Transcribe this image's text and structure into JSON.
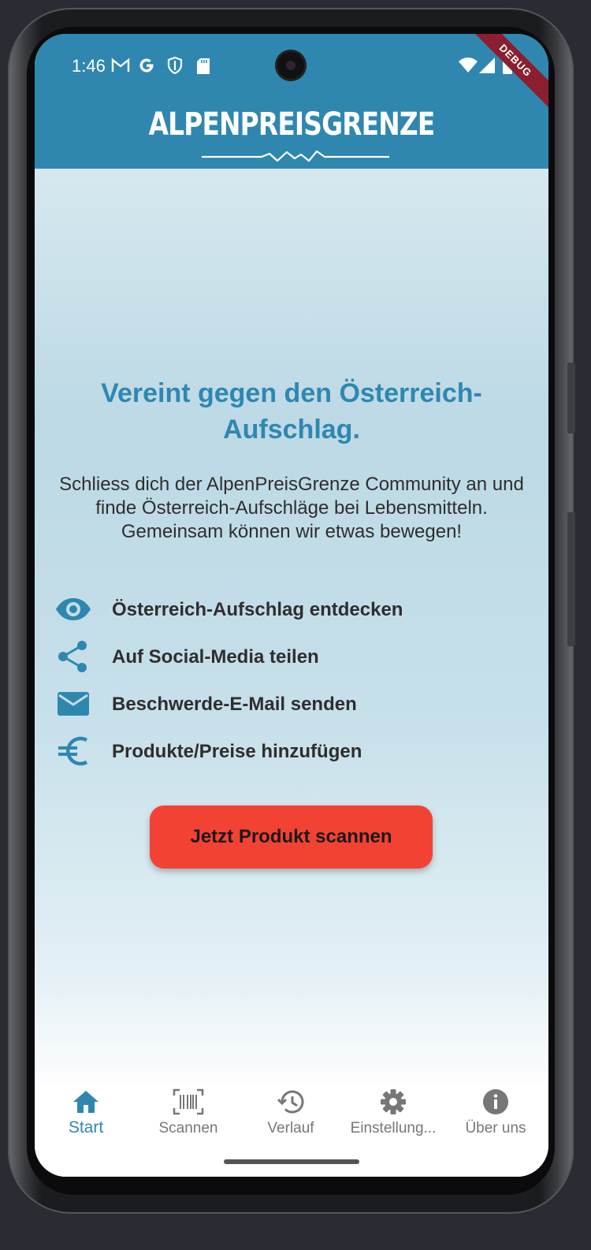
{
  "status_bar": {
    "time": "1:46"
  },
  "app_bar": {
    "logo_text": "ALPENPREISGRENZE",
    "debug_banner": "DEBUG",
    "color": "#2f87b0"
  },
  "main": {
    "headline": "Vereint gegen den Österreich-Aufschlag.",
    "description": "Schliess dich der AlpenPreisGrenze Community an und finde Österreich-Aufschläge bei Lebensmitteln. Gemeinsam können wir etwas bewegen!",
    "features": [
      {
        "icon": "eye-icon",
        "label": "Österreich-Aufschlag entdecken"
      },
      {
        "icon": "share-icon",
        "label": "Auf Social-Media teilen"
      },
      {
        "icon": "mail-icon",
        "label": "Beschwerde-E-Mail senden"
      },
      {
        "icon": "euro-icon",
        "label": "Produkte/Preise hinzufügen"
      }
    ],
    "cta_label": "Jetzt Produkt scannen",
    "cta_color": "#f24234"
  },
  "bottom_nav": {
    "items": [
      {
        "icon": "home-icon",
        "label": "Start",
        "active": true
      },
      {
        "icon": "barcode-icon",
        "label": "Scannen",
        "active": false
      },
      {
        "icon": "history-icon",
        "label": "Verlauf",
        "active": false
      },
      {
        "icon": "gear-icon",
        "label": "Einstellung...",
        "active": false
      },
      {
        "icon": "info-icon",
        "label": "Über uns",
        "active": false
      }
    ]
  }
}
